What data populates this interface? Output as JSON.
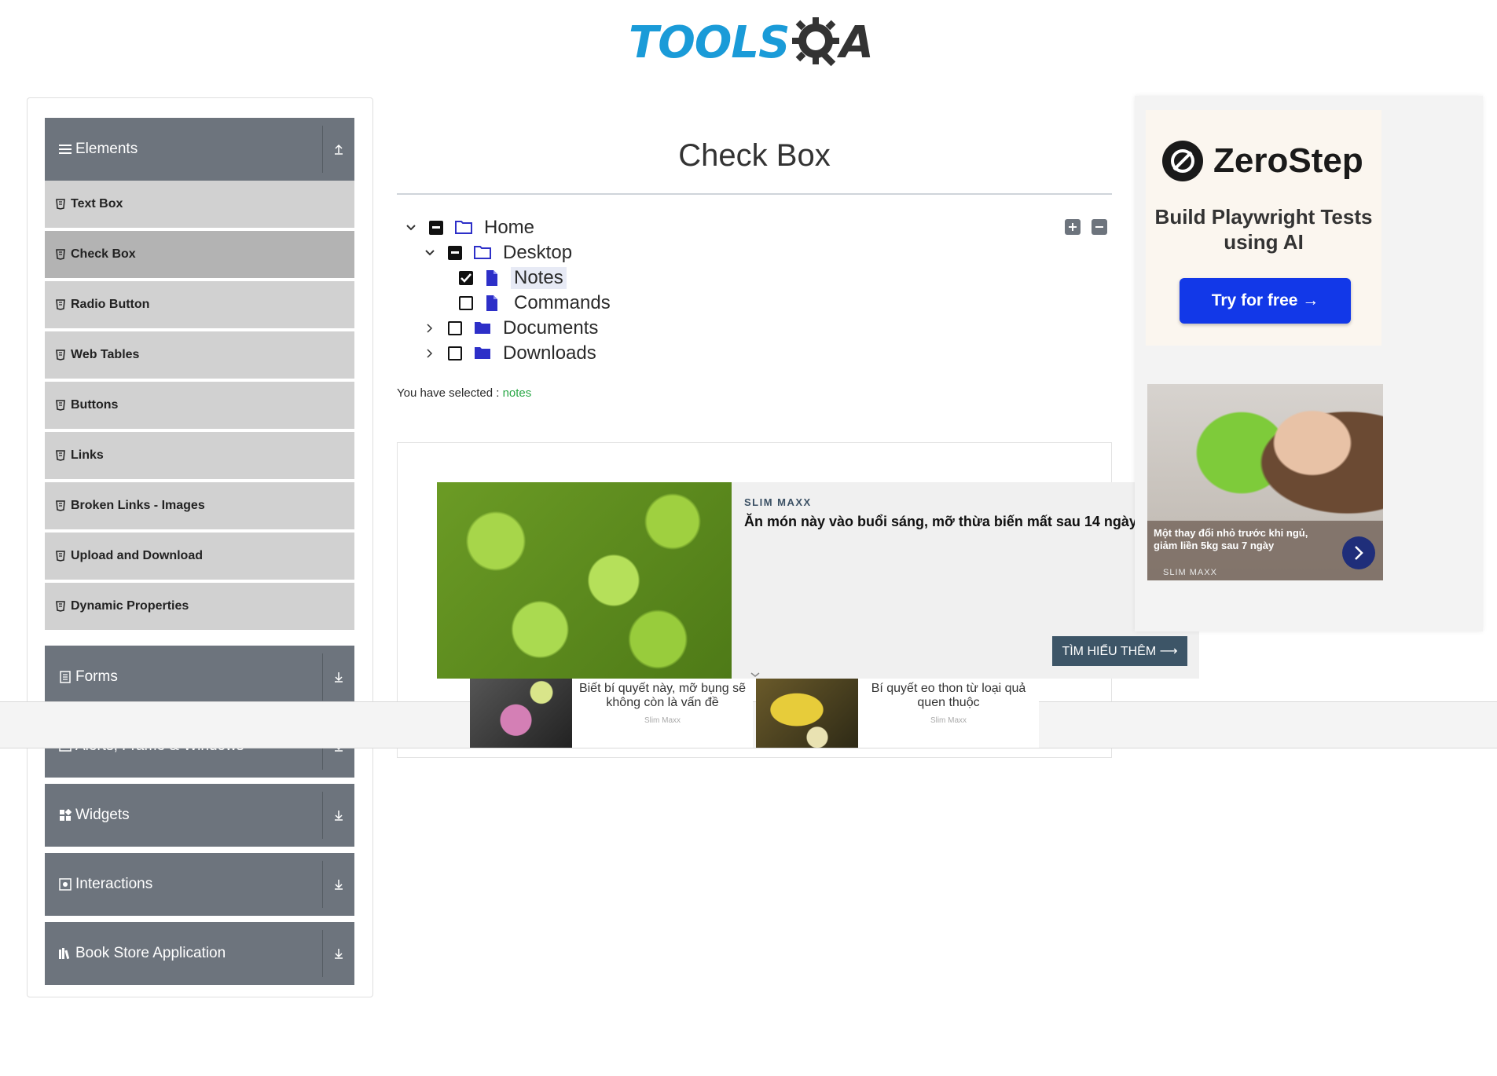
{
  "header": {
    "logo_text": "TOOLS",
    "logo_suffix": "A"
  },
  "sidebar": {
    "groups": [
      {
        "label": "Elements",
        "icon": "hamburger-icon",
        "expanded": true
      },
      {
        "label": "Forms",
        "icon": "form-icon",
        "expanded": false
      },
      {
        "label": "Alerts, Frame & Windows",
        "icon": "window-icon",
        "expanded": false
      },
      {
        "label": "Widgets",
        "icon": "widgets-icon",
        "expanded": false
      },
      {
        "label": "Interactions",
        "icon": "interactions-icon",
        "expanded": false
      },
      {
        "label": "Book Store Application",
        "icon": "books-icon",
        "expanded": false
      }
    ],
    "items": [
      {
        "label": "Text Box"
      },
      {
        "label": "Check Box",
        "active": true
      },
      {
        "label": "Radio Button"
      },
      {
        "label": "Web Tables"
      },
      {
        "label": "Buttons"
      },
      {
        "label": "Links"
      },
      {
        "label": "Broken Links - Images"
      },
      {
        "label": "Upload and Download"
      },
      {
        "label": "Dynamic Properties"
      }
    ]
  },
  "main": {
    "title": "Check Box",
    "tree": [
      {
        "label": "Home",
        "state": "half",
        "expanded": true,
        "type": "folder-open"
      },
      {
        "label": "Desktop",
        "state": "half",
        "expanded": true,
        "type": "folder-open"
      },
      {
        "label": "Notes",
        "state": "checked",
        "type": "file"
      },
      {
        "label": "Commands",
        "state": "unchecked",
        "type": "file"
      },
      {
        "label": "Documents",
        "state": "unchecked",
        "expanded": false,
        "type": "folder"
      },
      {
        "label": "Downloads",
        "state": "unchecked",
        "expanded": false,
        "type": "folder"
      }
    ],
    "result_prefix": "You have selected :",
    "result_value": "notes"
  },
  "ads": {
    "main": {
      "brand": "SLIM MAXX",
      "headline": "Ăn món này vào buổi sáng, mỡ thừa biến mất sau 14 ngày",
      "cta": "TÌM HIỂU THÊM ⟶"
    },
    "tiles": [
      {
        "text": "Biết bí quyết này, mỡ bụng sẽ không còn là vấn đề",
        "source": "Slim Maxx"
      },
      {
        "text": "Bí quyết eo thon từ loại quả quen thuộc",
        "source": "Slim Maxx"
      }
    ],
    "zerostep": {
      "name": "ZeroStep",
      "tagline": "Build Playwright Tests using AI",
      "cta": "Try for free →"
    },
    "slimmaxx_side": {
      "text": "Một thay đổi nhỏ trước khi ngủ, giảm liền 5kg sau 7 ngày",
      "source": "SLIM MAXX"
    }
  },
  "colors": {
    "accent": "#1a9bd8",
    "sidebar_header": "#6d747d",
    "menu_item": "#d1d1d1",
    "selected_text": "#28a745",
    "zerostep_button": "#1238e8"
  }
}
